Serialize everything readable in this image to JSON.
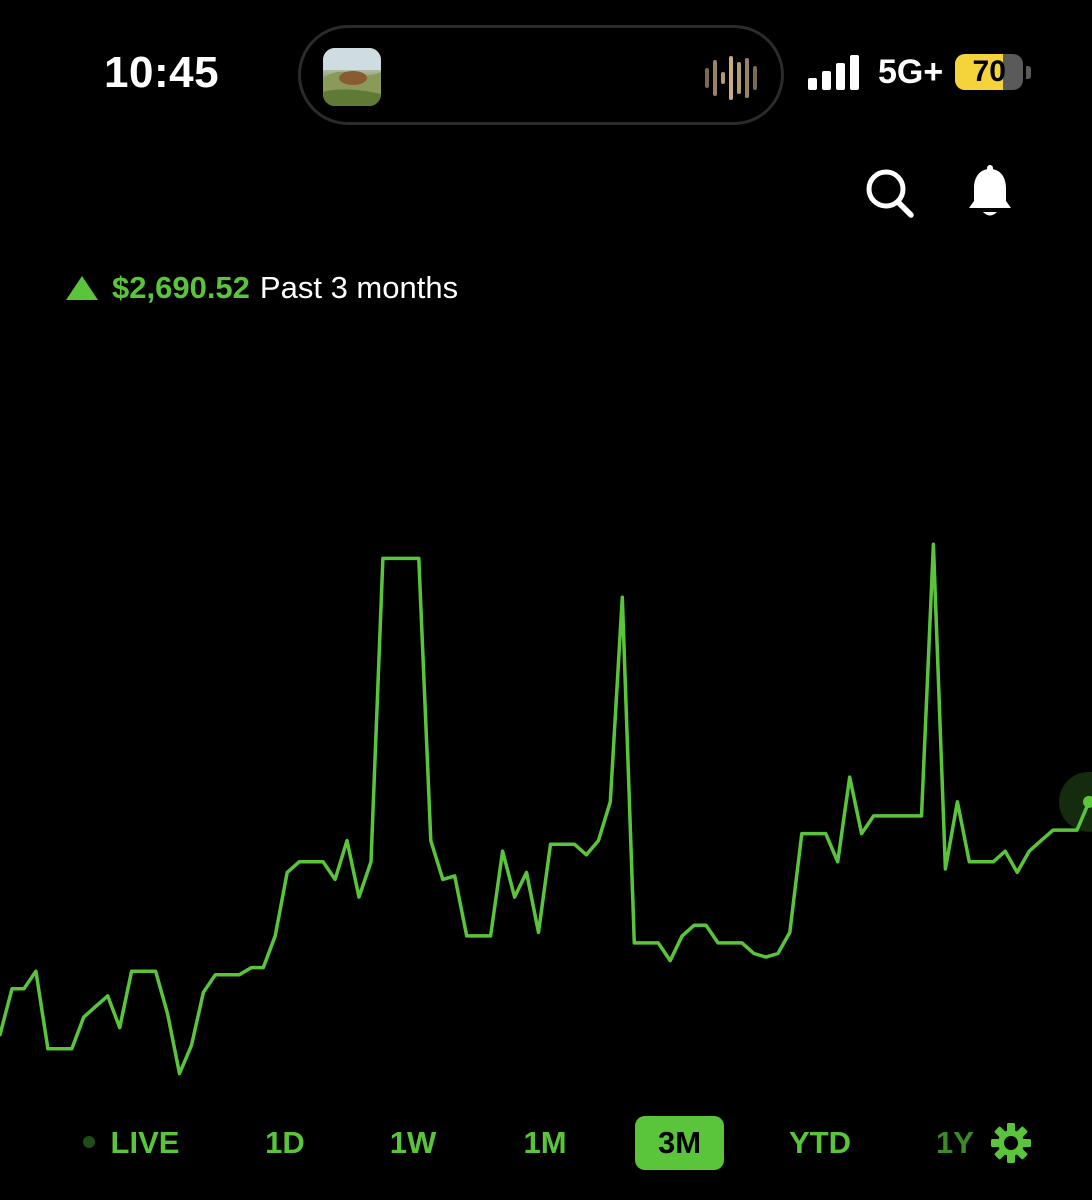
{
  "status_bar": {
    "time": "10:45",
    "network": "5G+",
    "battery_percent": "70",
    "battery_level": 0.7,
    "signal_bars": 4,
    "now_playing_art_icon": "album-art",
    "now_playing_waveform_icon": "audio-waveform-icon"
  },
  "header": {
    "search_icon": "search-icon",
    "notifications_icon": "bell-icon"
  },
  "summary": {
    "direction_icon": "triangle-up-icon",
    "gain_amount": "$2,690.52",
    "period_label": "Past 3 months"
  },
  "colors": {
    "accent_green": "#5ac53b",
    "background": "#000000",
    "battery_yellow": "#f5d33a"
  },
  "chart_data": {
    "type": "line",
    "title": "",
    "xlabel": "",
    "ylabel": "",
    "grid": false,
    "legend": "none",
    "ylim": [
      0,
      100
    ],
    "series": [
      {
        "values": [
          12,
          25,
          25,
          30,
          8,
          8,
          8,
          17,
          20,
          23,
          14,
          30,
          30,
          30,
          18,
          1,
          9,
          24,
          29,
          29,
          29,
          31,
          31,
          40,
          58,
          61,
          61,
          61,
          56,
          67,
          51,
          61,
          147,
          147,
          147,
          147,
          67,
          56,
          57,
          40,
          40,
          40,
          64,
          51,
          58,
          41,
          66,
          66,
          66,
          63,
          67,
          78,
          136,
          38,
          38,
          38,
          33,
          40,
          43,
          43,
          38,
          38,
          38,
          35,
          34,
          35,
          41,
          69,
          69,
          69,
          61,
          85,
          69,
          74,
          74,
          74,
          74,
          74,
          151,
          59,
          78,
          61,
          61,
          61,
          64,
          58,
          64,
          67,
          70,
          70,
          70,
          78
        ]
      }
    ],
    "end_marker": true
  },
  "range_selector": {
    "options": [
      {
        "label": "LIVE",
        "active": false
      },
      {
        "label": "1D",
        "active": false
      },
      {
        "label": "1W",
        "active": false
      },
      {
        "label": "1M",
        "active": false
      },
      {
        "label": "3M",
        "active": true
      },
      {
        "label": "YTD",
        "active": false
      },
      {
        "label": "1Y",
        "active": false
      }
    ],
    "settings_icon": "gear-icon"
  }
}
